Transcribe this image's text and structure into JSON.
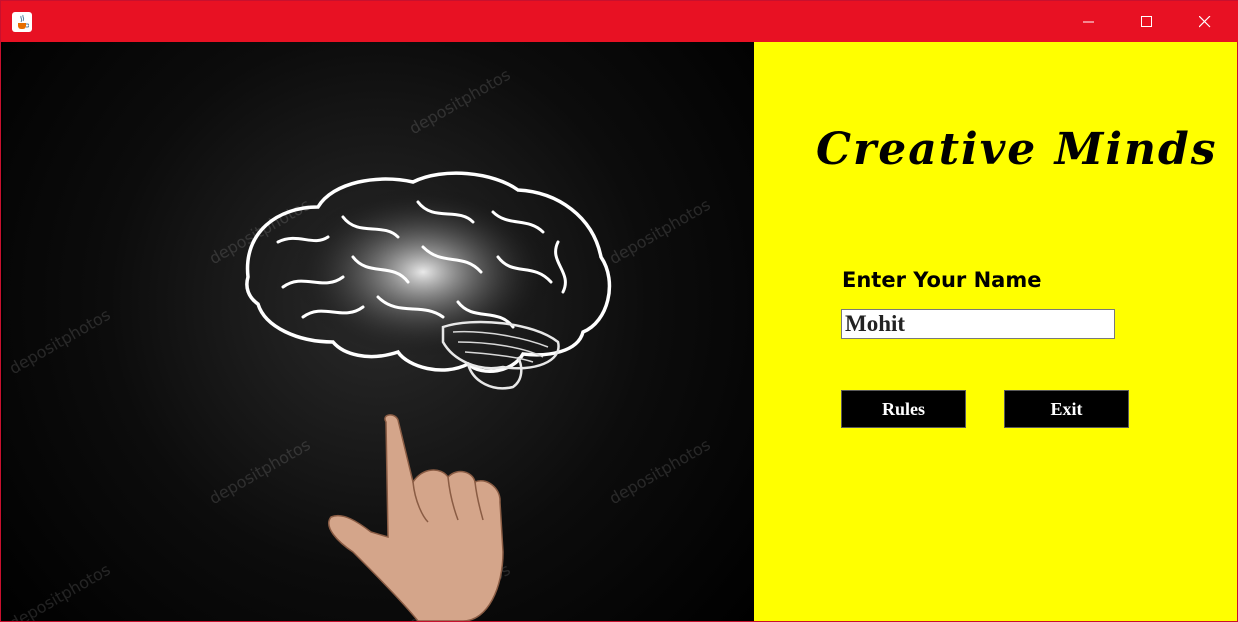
{
  "window": {
    "icon": "java-cup-icon",
    "title_bar_color": "#e81123",
    "controls": {
      "minimize": "minimize-icon",
      "maximize": "maximize-icon",
      "close": "close-icon"
    }
  },
  "image_panel": {
    "watermark": "depositphotos",
    "description_icon": "brain-icon"
  },
  "side_panel": {
    "background": "#ffff00",
    "heading": "Creative Minds",
    "name_prompt": "Enter Your Name",
    "name_input": {
      "value": "Mohit"
    },
    "rules_button": "Rules",
    "exit_button": "Exit"
  }
}
